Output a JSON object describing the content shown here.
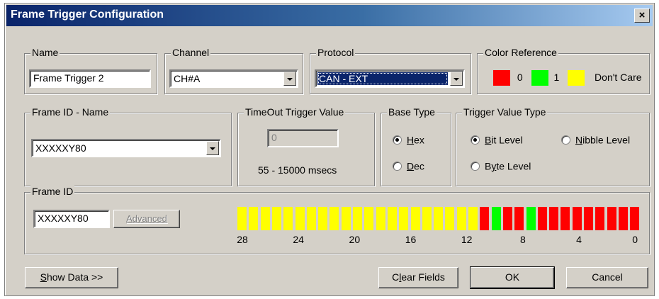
{
  "window": {
    "title": "Frame Trigger Configuration",
    "close_glyph": "×"
  },
  "name_group": {
    "label": "Name",
    "value": "Frame Trigger 2"
  },
  "channel_group": {
    "label": "Channel",
    "value": "CH#A"
  },
  "protocol_group": {
    "label": "Protocol",
    "value": "CAN - EXT"
  },
  "color_reference": {
    "label": "Color Reference",
    "items": [
      {
        "text": "0",
        "color": "#ff0000"
      },
      {
        "text": "1",
        "color": "#00ff00"
      },
      {
        "text": "Don't Care",
        "color": "#ffff00"
      }
    ]
  },
  "frame_id_name": {
    "label": "Frame ID - Name",
    "value": "XXXXXY80"
  },
  "timeout": {
    "label": "TimeOut Trigger Value",
    "value": "0",
    "range": "55 - 15000 msecs"
  },
  "base_type": {
    "label": "Base Type",
    "options": [
      {
        "label": "Hex",
        "mnemonic_first": "H",
        "rest": "ex",
        "checked": true
      },
      {
        "label": "Dec",
        "mnemonic_first": "D",
        "rest": "ec",
        "checked": false
      }
    ]
  },
  "trigger_value_type": {
    "label": "Trigger Value Type",
    "bit_level": {
      "pre": "",
      "mn": "B",
      "post": "it Level",
      "checked": true
    },
    "nibble_level": {
      "pre": "",
      "mn": "N",
      "post": "ibble Level",
      "checked": false
    },
    "byte_level": {
      "pre": "B",
      "mn": "y",
      "post": "te Level",
      "checked": false
    }
  },
  "frame_id": {
    "label": "Frame  ID",
    "value": "XXXXXY80",
    "advanced_label": "Advanced",
    "bits": [
      "Y",
      "Y",
      "Y",
      "Y",
      "Y",
      "Y",
      "Y",
      "Y",
      "Y",
      "Y",
      "Y",
      "Y",
      "Y",
      "Y",
      "Y",
      "Y",
      "Y",
      "Y",
      "Y",
      "Y",
      "Y",
      "0",
      "1",
      "0",
      "0",
      "1",
      "0",
      "0",
      "0",
      "0",
      "0",
      "0",
      "0",
      "0",
      "0"
    ],
    "bit_numbers": [
      "28",
      "24",
      "20",
      "16",
      "12",
      "8",
      "4",
      "0"
    ]
  },
  "buttons": {
    "show_data": {
      "mn": "S",
      "rest": "how Data >>"
    },
    "clear_fields": {
      "pre": "C",
      "mn": "l",
      "rest": "ear Fields"
    },
    "ok": "OK",
    "cancel": "Cancel"
  }
}
